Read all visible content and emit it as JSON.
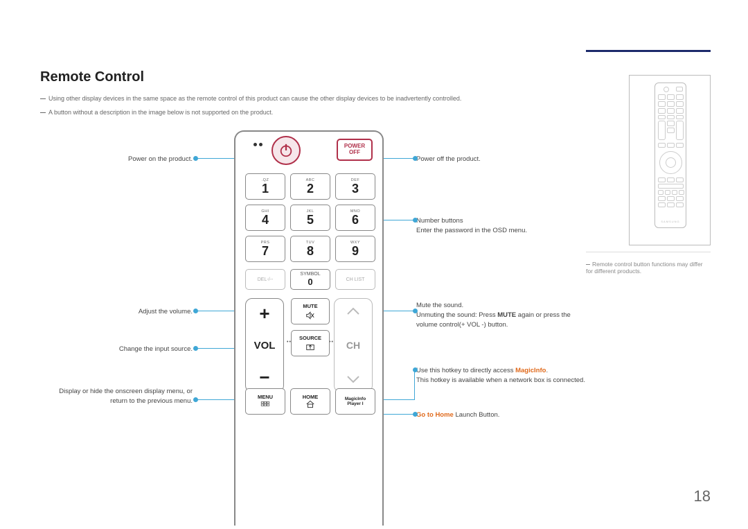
{
  "title": "Remote Control",
  "notes": {
    "n1": "Using other display devices in the same space as the remote control of this product can cause the other display devices to be inadvertently controlled.",
    "n2": "A button without a description in the image below is not supported on the product."
  },
  "thumb_note": "Remote control button functions may differ for different products.",
  "page_number": "18",
  "callouts": {
    "left": {
      "power_on": "Power on the product.",
      "volume": "Adjust the volume.",
      "source": "Change the input source.",
      "menu": "Display or hide the onscreen display menu, or return to the previous menu."
    },
    "right": {
      "power_off": "Power off the product.",
      "number_title": "Number buttons",
      "number_desc": "Enter the password in the OSD menu.",
      "mute_title": "Mute the sound.",
      "mute_desc_pre": "Unmuting the sound: Press ",
      "mute_desc_bold": "MUTE",
      "mute_desc_post": " again or press the volume control(+ VOL -) button.",
      "magic_pre": "Use this hotkey to directly access ",
      "magic_bold": "MagicInfo",
      "magic_post": ".",
      "magic_desc": "This hotkey is available when a network box is connected.",
      "home_pre": "Go to Home",
      "home_post": " Launch Button."
    }
  },
  "remote": {
    "power_off_top": "POWER",
    "power_off_bottom": "OFF",
    "num": [
      {
        "sub": ".QZ",
        "n": "1"
      },
      {
        "sub": "ABC",
        "n": "2"
      },
      {
        "sub": "DEF",
        "n": "3"
      },
      {
        "sub": "GHI",
        "n": "4"
      },
      {
        "sub": "JKL",
        "n": "5"
      },
      {
        "sub": "MNO",
        "n": "6"
      },
      {
        "sub": "PRS",
        "n": "7"
      },
      {
        "sub": "TUV",
        "n": "8"
      },
      {
        "sub": "WXY",
        "n": "9"
      }
    ],
    "row4": {
      "del": "DEL-/--",
      "symbol": "SYMBOL",
      "zero": "0",
      "chlist": "CH LIST"
    },
    "vol": {
      "plus": "+",
      "lbl": "VOL",
      "minus": "−"
    },
    "ch": {
      "lbl": "CH"
    },
    "mid": {
      "mute": "MUTE",
      "source": "SOURCE"
    },
    "bottom": {
      "menu": "MENU",
      "home": "HOME",
      "magic_l1": "MagicInfo",
      "magic_l2": "Player I"
    }
  }
}
